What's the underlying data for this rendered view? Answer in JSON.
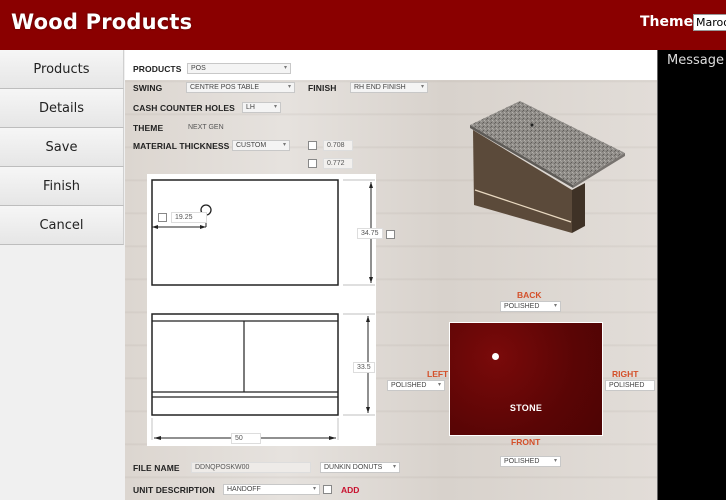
{
  "header": {
    "title": "Wood Products",
    "theme_label": "Theme",
    "theme_value": "Maroon"
  },
  "sidebar": {
    "items": [
      {
        "label": "Products"
      },
      {
        "label": "Details"
      },
      {
        "label": "Save"
      },
      {
        "label": "Finish"
      },
      {
        "label": "Cancel"
      }
    ]
  },
  "message_panel": {
    "title": "Message"
  },
  "form": {
    "products": {
      "label": "PRODUCTS",
      "value": "POS"
    },
    "swing": {
      "label": "SWING",
      "value": "CENTRE POS TABLE"
    },
    "finish": {
      "label": "FINISH",
      "value": "RH END FINISH"
    },
    "cash_counter_holes": {
      "label": "CASH COUNTER HOLES",
      "value": "LH"
    },
    "theme": {
      "label": "THEME",
      "value": "NEXT GEN"
    },
    "material_thickness": {
      "label": "MATERIAL THICKNESS",
      "value": "CUSTOM"
    },
    "thickness_options": [
      {
        "value": "0.708",
        "checked": false
      },
      {
        "value": "0.772",
        "checked": false
      }
    ],
    "file_name": {
      "label": "FILE NAME",
      "value": "DDNQPOSKW00"
    },
    "brand": {
      "value": "DUNKIN DONUTS"
    },
    "unit_description": {
      "label": "UNIT DESCRIPTION",
      "value": "HANDOFF",
      "checked": false
    },
    "add_label": "ADD"
  },
  "drawing": {
    "hole_offset": "19.25",
    "depth": "34.75",
    "height": "33.5",
    "width": "50"
  },
  "edges": {
    "back": {
      "label": "BACK",
      "value": "POLISHED"
    },
    "left": {
      "label": "LEFT",
      "value": "POLISHED"
    },
    "right": {
      "label": "RIGHT",
      "value": "POLISHED"
    },
    "front": {
      "label": "FRONT",
      "value": "POLISHED"
    },
    "material_label": "STONE"
  },
  "colors": {
    "header_bg": "#8a0000",
    "stone": "#5a0505",
    "edge_label": "#d4502a",
    "add": "#c8102e"
  }
}
